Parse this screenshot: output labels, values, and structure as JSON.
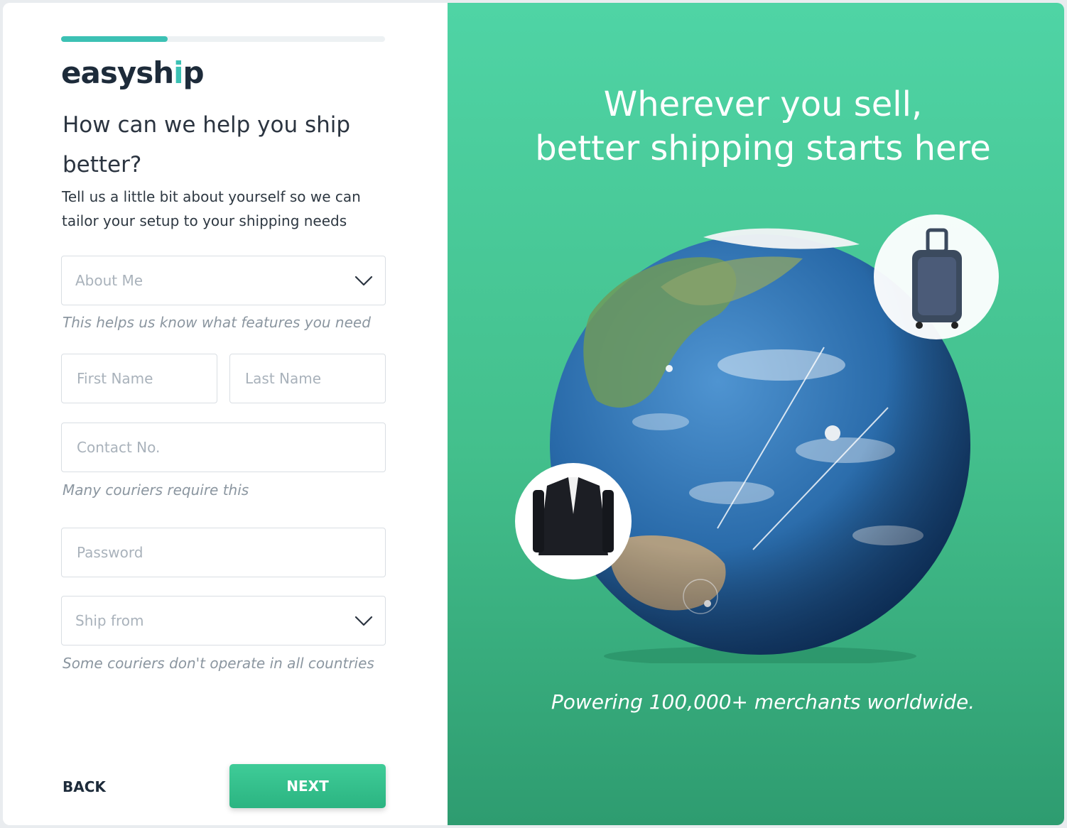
{
  "brand": {
    "logo_text_main": "easysh",
    "logo_text_accent": "i",
    "logo_text_end": "p"
  },
  "progress": {
    "fraction": 0.33
  },
  "form": {
    "heading": "How can we help you ship better?",
    "subtext": "Tell us a little bit about yourself so we can tailor your setup to your shipping needs",
    "about_me": {
      "placeholder": "About Me",
      "hint": "This helps us know what features you need"
    },
    "first_name": {
      "placeholder": "First Name"
    },
    "last_name": {
      "placeholder": "Last Name"
    },
    "contact": {
      "placeholder": "Contact No.",
      "hint": "Many couriers require this"
    },
    "password": {
      "placeholder": "Password"
    },
    "ship_from": {
      "placeholder": "Ship from",
      "hint": "Some couriers don't operate in all countries"
    }
  },
  "actions": {
    "back_label": "BACK",
    "next_label": "NEXT"
  },
  "promo": {
    "tagline_line1": "Wherever you sell,",
    "tagline_line2": "better shipping starts here",
    "powering": "Powering 100,000+ merchants worldwide.",
    "icons": [
      "globe-icon",
      "suitcase-icon",
      "jacket-icon"
    ]
  },
  "colors": {
    "accent": "#3cc1b4",
    "button": "#2bb481",
    "panel": "#43bf8c"
  }
}
